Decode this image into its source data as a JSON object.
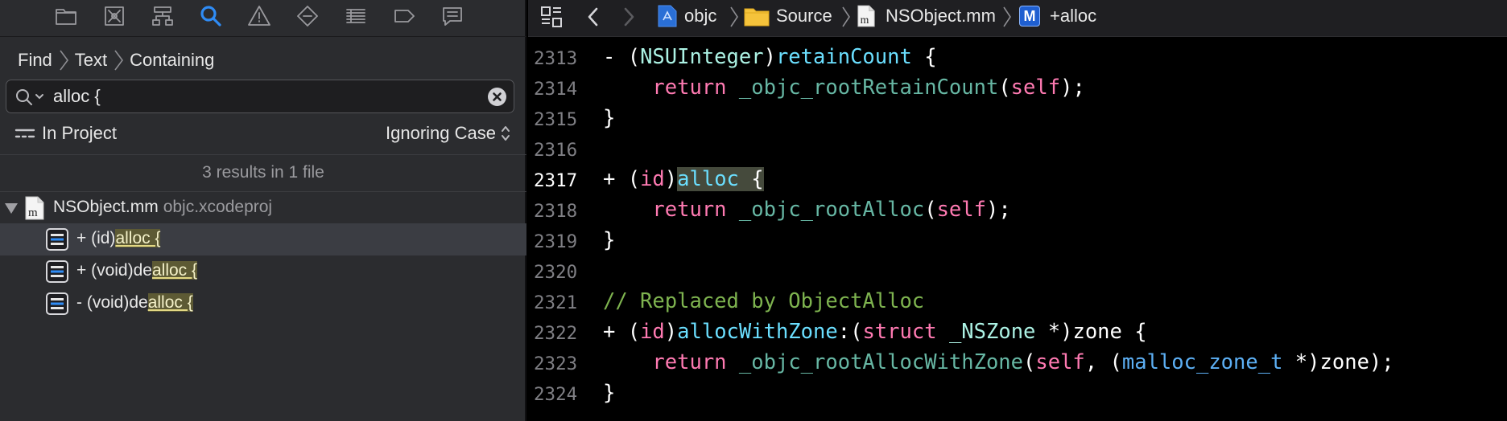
{
  "navigator": {
    "toolbar": [
      "project-navigator",
      "source-control-navigator",
      "symbol-navigator",
      "find-navigator",
      "issue-navigator",
      "test-navigator",
      "debug-navigator",
      "breakpoint-navigator",
      "report-navigator"
    ],
    "breadcrumb": [
      "Find",
      "Text",
      "Containing"
    ],
    "search": {
      "value": "alloc {"
    },
    "scope": "In Project",
    "case_mode": "Ignoring Case",
    "summary": "3 results in 1 file",
    "file": {
      "name": "NSObject.mm",
      "project": "objc.xcodeproj"
    },
    "results": [
      {
        "prefix": "+ (id)",
        "match": "alloc {",
        "selected": true
      },
      {
        "prefix": "+ (void)de",
        "match": "alloc {",
        "selected": false
      },
      {
        "prefix": "- (void)de",
        "match": "alloc {",
        "selected": false
      }
    ]
  },
  "jumpbar": {
    "items": [
      "objc",
      "Source",
      "NSObject.mm",
      "+alloc"
    ],
    "method_badge": "M"
  },
  "editor": {
    "current_line": "2317",
    "lines": [
      {
        "n": "2313",
        "text": "- (NSUInteger)retainCount {"
      },
      {
        "n": "2314",
        "text": "    return _objc_rootRetainCount(self);"
      },
      {
        "n": "2315",
        "text": "}"
      },
      {
        "n": "2316",
        "text": ""
      },
      {
        "n": "2317",
        "text": "+ (id)alloc {"
      },
      {
        "n": "2318",
        "text": "    return _objc_rootAlloc(self);"
      },
      {
        "n": "2319",
        "text": "}"
      },
      {
        "n": "2320",
        "text": ""
      },
      {
        "n": "2321",
        "text": "// Replaced by ObjectAlloc"
      },
      {
        "n": "2322",
        "text": "+ (id)allocWithZone:(struct _NSZone *)zone {"
      },
      {
        "n": "2323",
        "text": "    return _objc_rootAllocWithZone(self, (malloc_zone_t *)zone);"
      },
      {
        "n": "2324",
        "text": "}"
      }
    ]
  }
}
